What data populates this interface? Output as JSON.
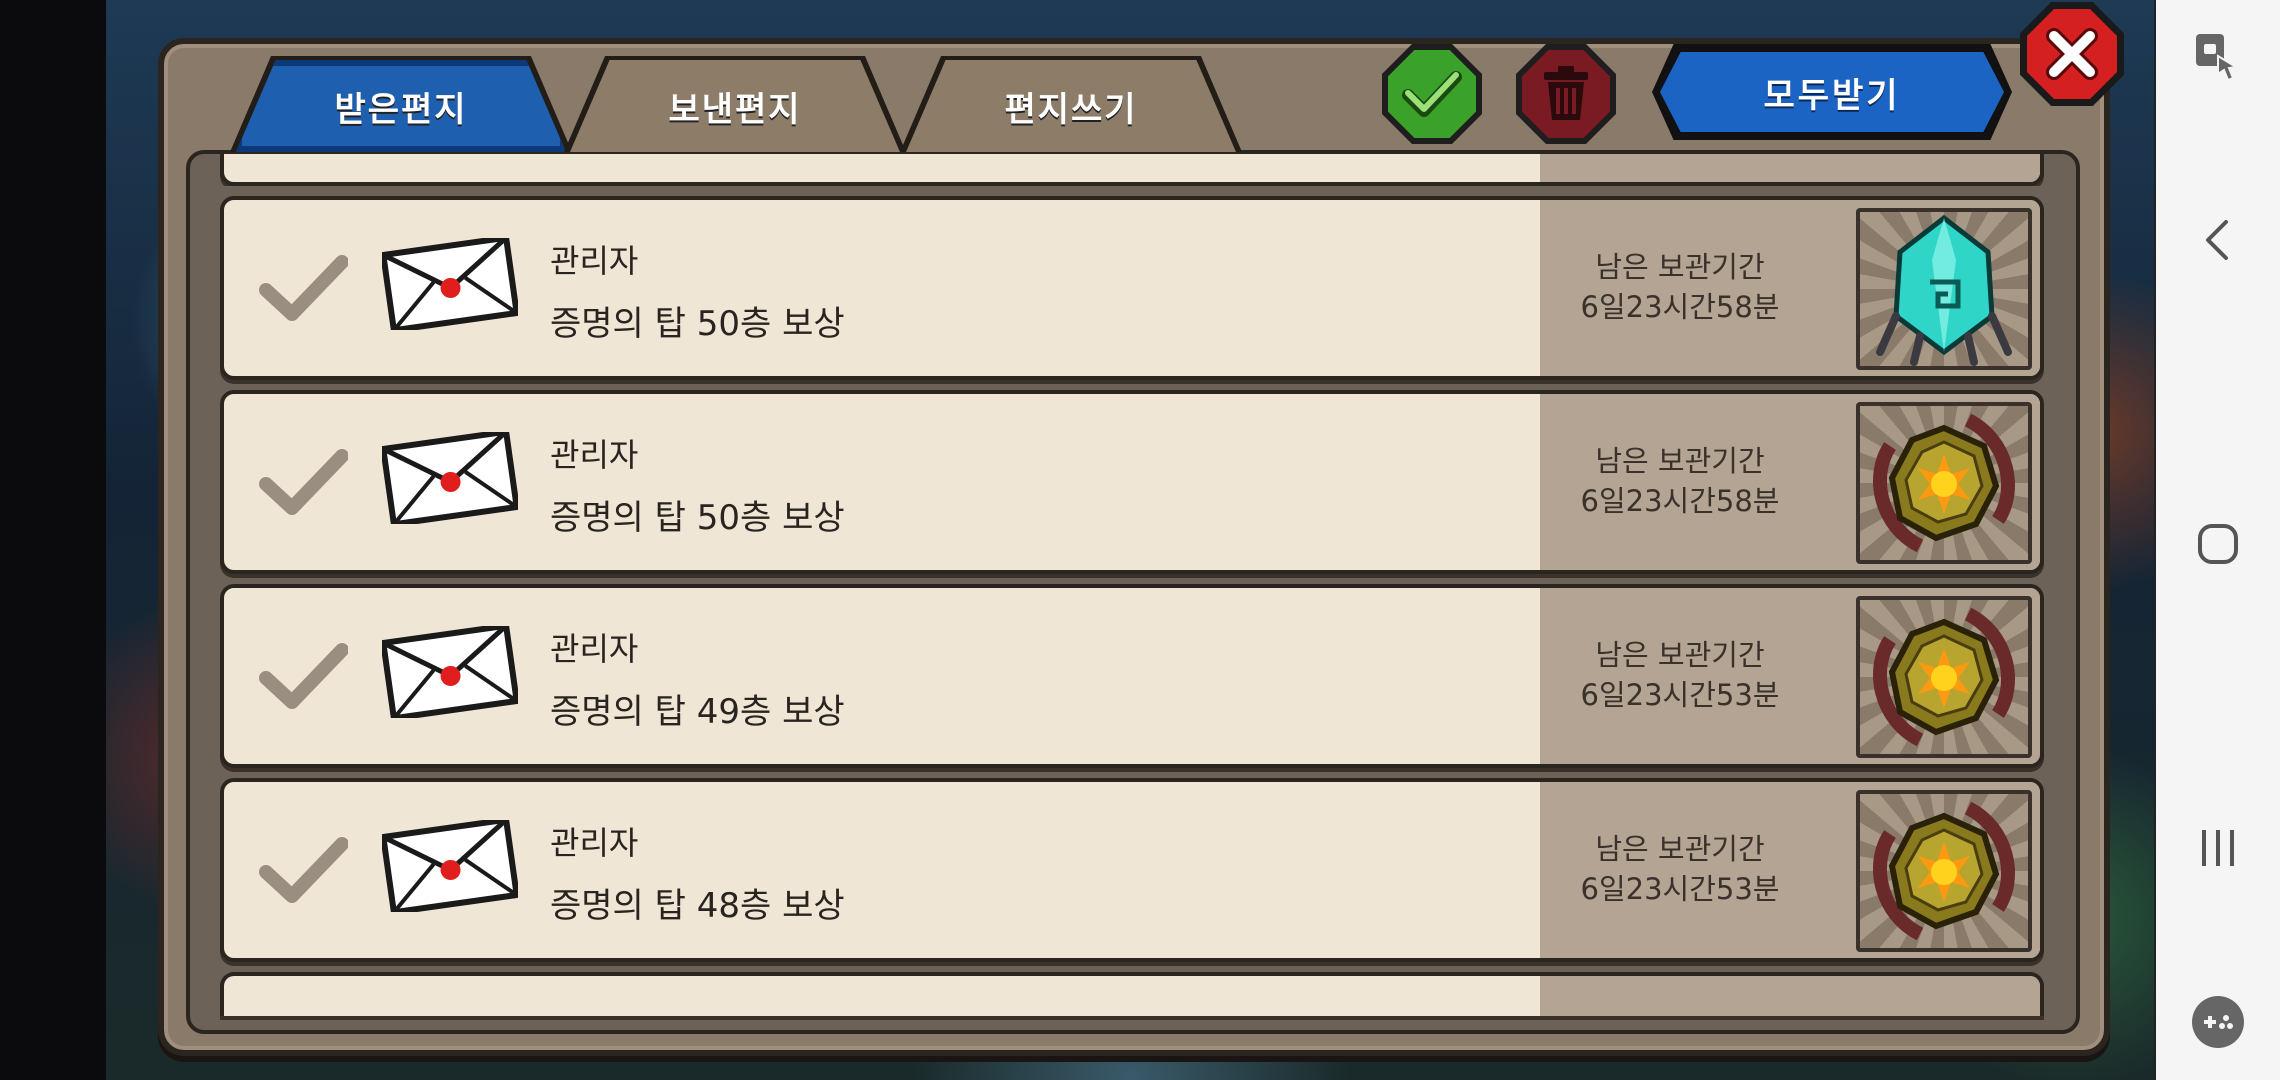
{
  "tabs": {
    "received": "받은편지",
    "sent": "보낸편지",
    "write": "편지쓰기"
  },
  "actions": {
    "receive_all": "모두받기"
  },
  "mails": [
    {
      "sender": "관리자",
      "subject": "증명의 탑 50층 보상",
      "remain_label": "남은 보관기간",
      "remain_time": "6일23시간58분",
      "reward": "crystal-gem-icon"
    },
    {
      "sender": "관리자",
      "subject": "증명의 탑 50층 보상",
      "remain_label": "남은 보관기간",
      "remain_time": "6일23시간58분",
      "reward": "sun-medal-icon"
    },
    {
      "sender": "관리자",
      "subject": "증명의 탑 49층 보상",
      "remain_label": "남은 보관기간",
      "remain_time": "6일23시간53분",
      "reward": "sun-medal-icon"
    },
    {
      "sender": "관리자",
      "subject": "증명의 탑 48층 보상",
      "remain_label": "남은 보관기간",
      "remain_time": "6일23시간53분",
      "reward": "sun-medal-icon"
    }
  ],
  "colors": {
    "tab_active": "#1f5fb0",
    "check_button": "#3aa12a",
    "delete_button": "#7a1a22",
    "receive_all": "#1c64c4",
    "close_button": "#d42020"
  }
}
